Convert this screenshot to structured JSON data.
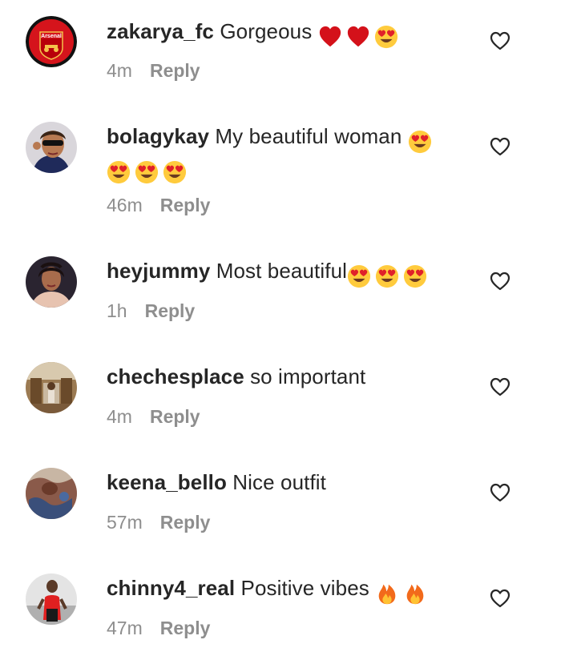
{
  "comments": [
    {
      "username": "zakarya_fc",
      "text": "Gorgeous",
      "emojis": [
        "heart-emoji",
        "heart-emoji",
        "heart-eyes-emoji"
      ],
      "time": "4m",
      "reply_label": "Reply",
      "avatar_text": "Arsenal"
    },
    {
      "username": "bolagykay",
      "text": "My beautiful woman",
      "emojis": [
        "heart-eyes-emoji",
        "heart-eyes-emoji",
        "heart-eyes-emoji",
        "heart-eyes-emoji"
      ],
      "time": "46m",
      "reply_label": "Reply"
    },
    {
      "username": "heyjummy",
      "text": "Most beautiful",
      "emojis": [
        "heart-eyes-emoji",
        "heart-eyes-emoji",
        "heart-eyes-emoji"
      ],
      "time": "1h",
      "reply_label": "Reply"
    },
    {
      "username": "chechesplace",
      "text": "so important",
      "emojis": [],
      "time": "4m",
      "reply_label": "Reply"
    },
    {
      "username": "keena_bello",
      "text": "Nice outfit",
      "emojis": [],
      "time": "57m",
      "reply_label": "Reply"
    },
    {
      "username": "chinny4_real",
      "text": "Positive vibes",
      "emojis": [
        "fire-emoji",
        "fire-emoji"
      ],
      "time": "47m",
      "reply_label": "Reply"
    }
  ],
  "icons": {
    "like": "heart-outline-icon"
  },
  "colors": {
    "text": "#262626",
    "meta": "#8e8e8e",
    "emoji_heart": "#d4111a",
    "emoji_face": "#ffcb3d",
    "fire": "#f26a1b"
  }
}
